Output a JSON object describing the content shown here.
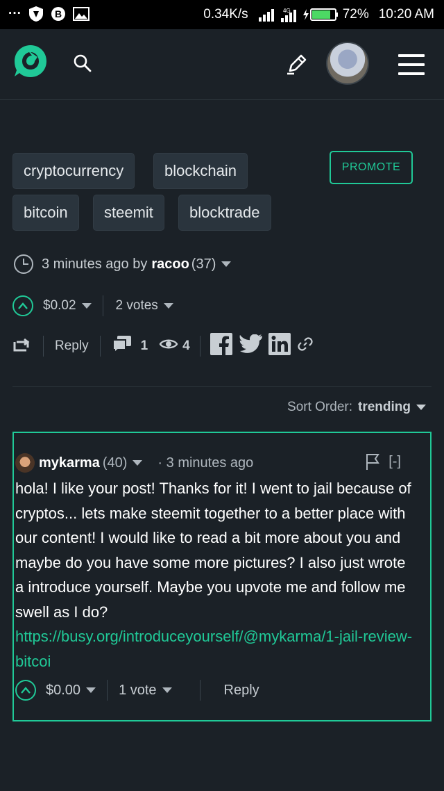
{
  "status_bar": {
    "dots": "···",
    "speed": "0.34K/s",
    "battery": "72%",
    "time": "10:20 AM"
  },
  "nav": {
    "icons": [
      "busy-logo-icon",
      "search-icon",
      "write-icon",
      "avatar",
      "hamburger-menu-icon"
    ]
  },
  "tags": [
    "cryptocurrency",
    "blockchain",
    "bitcoin",
    "steemit",
    "blocktrade"
  ],
  "promote_label": "PROMOTE",
  "post_meta": {
    "time_ago": "3 minutes ago by",
    "author": "racoo",
    "reputation": "(37)"
  },
  "post_votes": {
    "payout": "$0.02",
    "votes": "2 votes"
  },
  "post_actions": {
    "reply_label": "Reply",
    "comment_count": "1",
    "view_count": "4"
  },
  "sort": {
    "label": "Sort Order:",
    "value": "trending"
  },
  "comment": {
    "author": "mykarma",
    "reputation": "(40)",
    "time_ago": "· 3 minutes ago",
    "collapse": "[-]",
    "body": "hola! I like your post! Thanks for it! I went to jail because of cryptos... lets make steemit together to a better place with our content! I would like to read a bit more about you and maybe do you have some more pictures? I also just wrote a introduce yourself. Maybe you upvote me and follow me swell as I do?",
    "link": "https://busy.org/introduceyourself/@mykarma/1-jail-review-bitcoi",
    "payout": "$0.00",
    "votes": "1 vote",
    "reply_label": "Reply"
  },
  "colors": {
    "accent": "#20c997",
    "background": "#1b2127",
    "tag_bg": "#2a343d"
  }
}
